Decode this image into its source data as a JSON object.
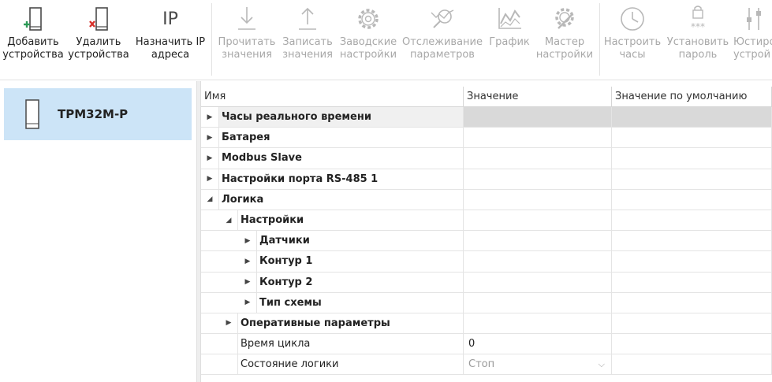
{
  "toolbar": {
    "buttons": [
      {
        "line1": "Добавить",
        "line2": "устройства",
        "icon": "add-device-icon",
        "enabled": true
      },
      {
        "line1": "Удалить",
        "line2": "устройства",
        "icon": "remove-device-icon",
        "enabled": true
      },
      {
        "line1": "Назначить IP",
        "line2": "адреса",
        "icon": "ip-icon",
        "icon_text": "IP",
        "enabled": true
      },
      {
        "line1": "Прочитать",
        "line2": "значения",
        "icon": "download-icon",
        "enabled": false
      },
      {
        "line1": "Записать",
        "line2": "значения",
        "icon": "upload-icon",
        "enabled": false
      },
      {
        "line1": "Заводские",
        "line2": "настройки",
        "icon": "factory-settings-gear-icon",
        "enabled": false
      },
      {
        "line1": "Отслеживание",
        "line2": "параметров",
        "icon": "tracking-icon",
        "enabled": false
      },
      {
        "line1": "График",
        "line2": "",
        "icon": "chart-icon",
        "enabled": false
      },
      {
        "line1": "Мастер",
        "line2": "настройки",
        "icon": "wizard-icon",
        "enabled": false
      },
      {
        "line1": "Настроить",
        "line2": "часы",
        "icon": "clock-icon",
        "enabled": false
      },
      {
        "line1": "Установить",
        "line2": "пароль",
        "icon": "password-icon",
        "icon_text": "***",
        "enabled": false
      },
      {
        "line1": "Юстиро",
        "line2": "устрой",
        "icon": "calibration-icon",
        "enabled": false
      }
    ]
  },
  "devices": [
    {
      "name": "ТРМ32М-Р",
      "icon": "device-icon",
      "selected": true
    }
  ],
  "grid": {
    "columns": [
      "Имя",
      "Значение",
      "Значение по умолчанию"
    ],
    "rows": [
      {
        "name": "Часы реального времени",
        "level": 0,
        "arrow": "collapsed",
        "group": true,
        "value": "",
        "default": "",
        "highlight": true
      },
      {
        "name": "Батарея",
        "level": 0,
        "arrow": "collapsed",
        "group": true,
        "value": "",
        "default": ""
      },
      {
        "name": "Modbus Slave",
        "level": 0,
        "arrow": "collapsed",
        "group": true,
        "value": "",
        "default": ""
      },
      {
        "name": "Настройки порта RS-485 1",
        "level": 0,
        "arrow": "collapsed",
        "group": true,
        "value": "",
        "default": ""
      },
      {
        "name": "Логика",
        "level": 0,
        "arrow": "expanded",
        "group": true,
        "value": "",
        "default": ""
      },
      {
        "name": "Настройки",
        "level": 1,
        "arrow": "expanded",
        "group": true,
        "value": "",
        "default": ""
      },
      {
        "name": "Датчики",
        "level": 2,
        "arrow": "collapsed",
        "group": true,
        "value": "",
        "default": ""
      },
      {
        "name": "Контур 1",
        "level": 2,
        "arrow": "collapsed",
        "group": true,
        "value": "",
        "default": ""
      },
      {
        "name": "Контур 2",
        "level": 2,
        "arrow": "collapsed",
        "group": true,
        "value": "",
        "default": ""
      },
      {
        "name": "Тип схемы",
        "level": 2,
        "arrow": "collapsed",
        "group": true,
        "value": "",
        "default": ""
      },
      {
        "name": "Оперативные параметры",
        "level": 1,
        "arrow": "collapsed",
        "group": true,
        "value": "",
        "default": ""
      },
      {
        "name": "Время цикла",
        "level": 1,
        "arrow": "none",
        "group": false,
        "value": "0",
        "default": ""
      },
      {
        "name": "Состояние логики",
        "level": 1,
        "arrow": "none",
        "group": false,
        "value": "Стоп",
        "value_type": "combo",
        "value_muted": true,
        "default": ""
      }
    ]
  },
  "colors": {
    "selection": "#cce4f7",
    "icon_dark": "#4a4a4a",
    "icon_disabled": "#b8b8b8",
    "add_green": "#2e9a57",
    "remove_red": "#d6302a",
    "disabled_text": "#a8a8a8"
  }
}
